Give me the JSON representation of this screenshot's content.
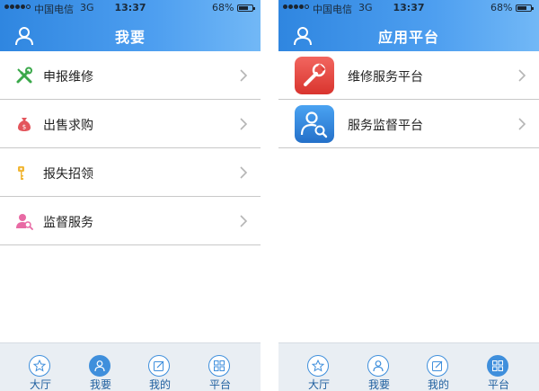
{
  "status_bar": {
    "carrier": "中国电信",
    "network": "3G",
    "time": "13:37",
    "battery": "68%",
    "battery_level": 0.68
  },
  "left_screen": {
    "title": "我要",
    "items": [
      {
        "label": "申报维修",
        "icon": "wrench-tools-icon"
      },
      {
        "label": "出售求购",
        "icon": "money-bag-icon"
      },
      {
        "label": "报失招领",
        "icon": "key-icon"
      },
      {
        "label": "监督服务",
        "icon": "person-search-icon"
      }
    ],
    "active_tab": "我要"
  },
  "right_screen": {
    "title": "应用平台",
    "items": [
      {
        "label": "维修服务平台",
        "icon": "wrench-app-icon",
        "color": "#e8463f"
      },
      {
        "label": "服务监督平台",
        "icon": "person-search-app-icon",
        "color": "#2f86e0"
      }
    ],
    "active_tab": "平台"
  },
  "tabs": [
    {
      "label": "大厅",
      "icon": "star-icon"
    },
    {
      "label": "我要",
      "icon": "person-icon"
    },
    {
      "label": "我的",
      "icon": "edit-icon"
    },
    {
      "label": "平台",
      "icon": "grid-icon"
    }
  ],
  "colors": {
    "header_start": "#2f86e0",
    "header_end": "#72b8f6",
    "tab_accent": "#3f8fdc",
    "tab_bar_bg": "#e9eef3"
  }
}
